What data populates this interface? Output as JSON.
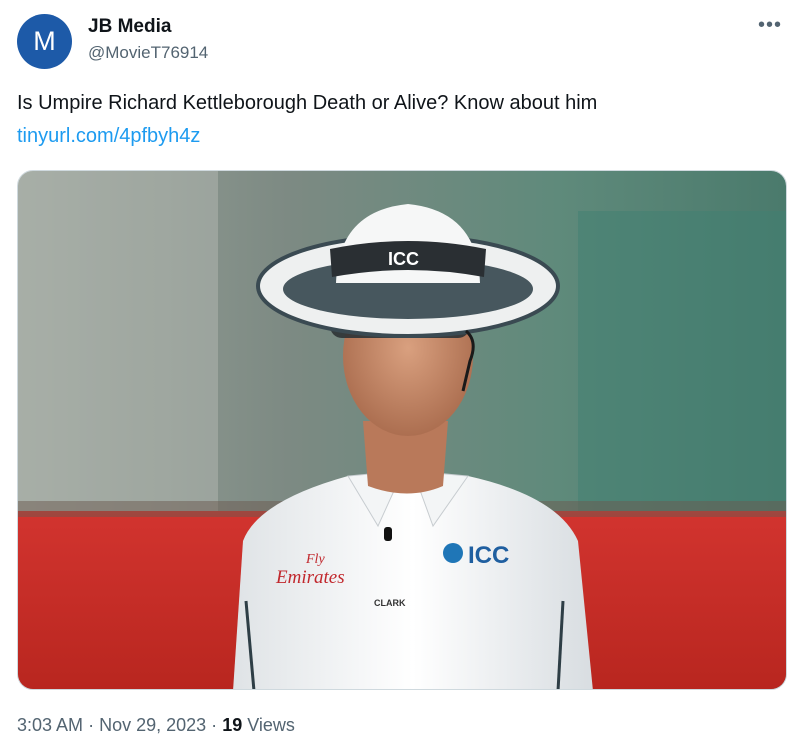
{
  "author": {
    "avatar_letter": "M",
    "name": "JB Media",
    "handle": "@MovieT76914"
  },
  "more_icon": "more-dots-icon",
  "tweet": {
    "text": "Is Umpire Richard Kettleborough Death or Alive? Know about him",
    "link": "tinyurl.com/4pfbyh4z"
  },
  "media": {
    "hat_band_text": "ICC",
    "shirt_logo": "ICC",
    "sponsor_line1": "Fly",
    "sponsor_line2": "Emirates",
    "button_brand": "CLARK"
  },
  "meta": {
    "time": "3:03 AM",
    "separator": "·",
    "date": "Nov 29, 2023",
    "views_count": "19",
    "views_label": "Views"
  },
  "colors": {
    "avatar": "#1d5aa8",
    "link": "#1d9bf0",
    "secondary_text": "#536471"
  }
}
